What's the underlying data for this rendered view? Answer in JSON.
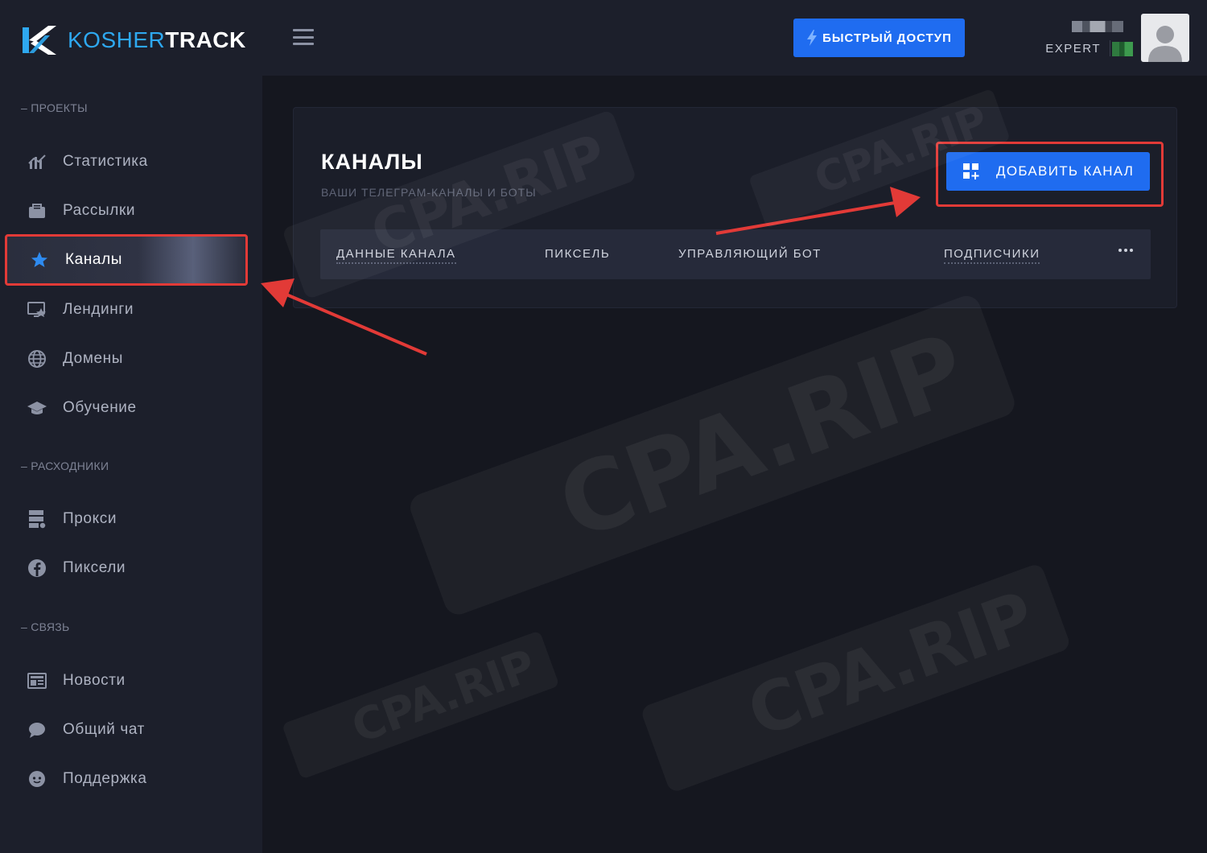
{
  "logo": {
    "part1": "KOSHER",
    "part2": "TRACK"
  },
  "sidebar": {
    "sections": [
      {
        "label": "– ПРОЕКТЫ"
      },
      {
        "label": "– РАСХОДНИКИ"
      },
      {
        "label": "– СВЯЗЬ"
      }
    ],
    "items": [
      {
        "label": "Статистика",
        "icon": "chart-icon"
      },
      {
        "label": "Рассылки",
        "icon": "mailbox-icon"
      },
      {
        "label": "Каналы",
        "icon": "star-icon",
        "active": true
      },
      {
        "label": "Лендинги",
        "icon": "monitor-icon"
      },
      {
        "label": "Домены",
        "icon": "globe-icon"
      },
      {
        "label": "Обучение",
        "icon": "graduation-cap-icon"
      },
      {
        "label": "Прокси",
        "icon": "server-icon"
      },
      {
        "label": "Пиксели",
        "icon": "facebook-icon"
      },
      {
        "label": "Новости",
        "icon": "newspaper-icon"
      },
      {
        "label": "Общий чат",
        "icon": "chat-icon"
      },
      {
        "label": "Поддержка",
        "icon": "support-icon"
      }
    ]
  },
  "topbar": {
    "quick_access": "БЫСТРЫЙ ДОСТУП",
    "user_role": "EXPERT"
  },
  "card": {
    "title": "КАНАЛЫ",
    "subtitle": "ВАШИ ТЕЛЕГРАМ-КАНАЛЫ И БОТЫ",
    "add_button": "ДОБАВИТЬ КАНАЛ",
    "columns": [
      "ДАННЫЕ КАНАЛА",
      "ПИКСЕЛЬ",
      "УПРАВЛЯЮЩИЙ БОТ",
      "ПОДПИСЧИКИ"
    ]
  },
  "watermark": "CPA.RIP",
  "colors": {
    "accent": "#1f6cf0",
    "highlight": "#e23a37",
    "logo_blue": "#2ea8f0"
  }
}
